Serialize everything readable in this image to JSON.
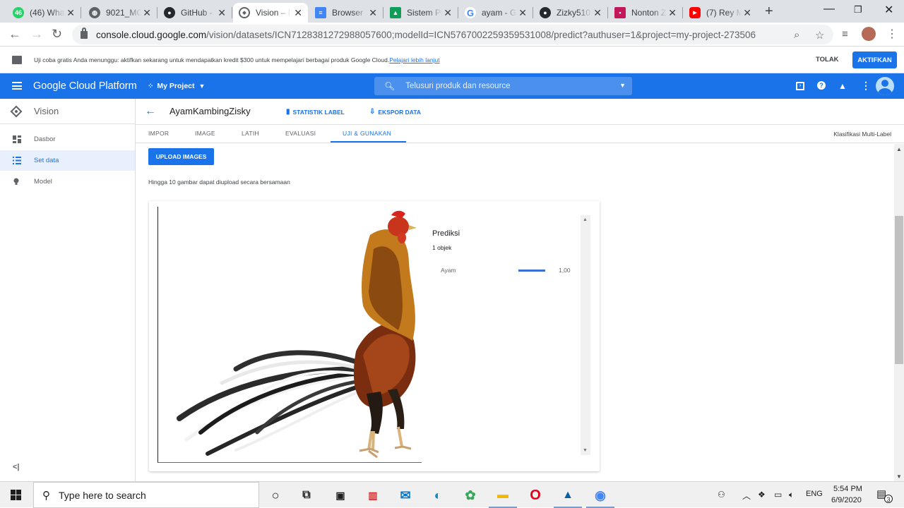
{
  "browser": {
    "tabs": [
      {
        "title": "(46) Wha",
        "icon": "whatsapp-icon",
        "color": "#25d366"
      },
      {
        "title": "9021_MC",
        "icon": "globe-icon",
        "color": "#5f6368"
      },
      {
        "title": "GitHub -",
        "icon": "github-icon",
        "color": "#24292e"
      },
      {
        "title": "Vision – I",
        "icon": "vision-icon",
        "color": "#5f6368",
        "active": true
      },
      {
        "title": "Browser",
        "icon": "doc-icon",
        "color": "#4285f4"
      },
      {
        "title": "Sistem Pe",
        "icon": "classroom-icon",
        "color": "#0f9d58"
      },
      {
        "title": "ayam - G",
        "icon": "google-icon",
        "color": "#4285f4"
      },
      {
        "title": "Zizky510",
        "icon": "github-icon",
        "color": "#24292e"
      },
      {
        "title": "Nonton Z",
        "icon": "film-icon",
        "color": "#c2185b"
      },
      {
        "title": "(7) Rey M",
        "icon": "youtube-icon",
        "color": "#ff0000"
      }
    ],
    "url_host": "console.cloud.google.com",
    "url_path": "/vision/datasets/ICN7128381272988057600;modelId=ICN5767002259359531008/predict?authuser=1&project=my-project-273506"
  },
  "banner": {
    "text": "Uji coba gratis Anda menunggu: aktifkan sekarang untuk mendapatkan kredit $300 untuk mempelajari berbagai produk Google Cloud.",
    "link": "Pelajari lebih lanjut",
    "dismiss": "TOLAK",
    "activate": "AKTIFKAN"
  },
  "header": {
    "title": "Google Cloud Platform",
    "project": "My Project",
    "search_placeholder": "Telusuri produk dan resource",
    "accent": "#1a73e8"
  },
  "sidebar": {
    "product": "Vision",
    "items": [
      {
        "label": "Dasbor",
        "icon": "dashboard-icon"
      },
      {
        "label": "Set data",
        "icon": "list-icon",
        "active": true
      },
      {
        "label": "Model",
        "icon": "bulb-icon"
      }
    ]
  },
  "dataset": {
    "name": "AyamKambingZisky",
    "stats_label": "STATISTIK LABEL",
    "export_label": "EKSPOR DATA",
    "tabs": [
      "IMPOR",
      "IMAGE",
      "LATIH",
      "EVALUASI",
      "UJI & GUNAKAN"
    ],
    "active_tab": "UJI & GUNAKAN",
    "classification_type": "Klasifikasi Multi-Label"
  },
  "predict": {
    "upload_button": "UPLOAD IMAGES",
    "hint": "Hingga 10 gambar dapat diupload secara bersamaan",
    "result_title": "Prediksi",
    "result_count": "1 objek",
    "label": "Ayam",
    "score": "1,00",
    "score_fraction": 1.0
  },
  "taskbar": {
    "search_placeholder": "Type here to search",
    "language": "ENG",
    "time": "5:54 PM",
    "date": "6/9/2020",
    "notifications": "3"
  }
}
